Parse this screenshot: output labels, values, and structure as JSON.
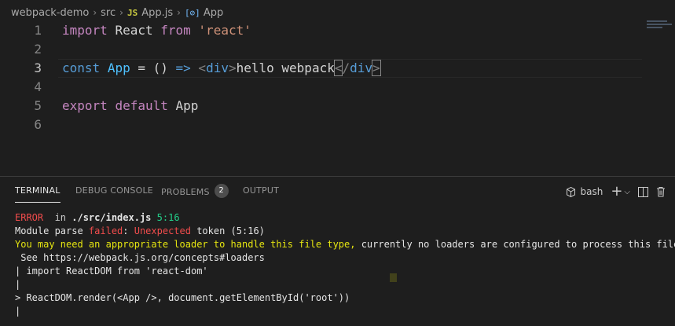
{
  "breadcrumb": {
    "items": [
      {
        "label": "webpack-demo"
      },
      {
        "label": "src"
      },
      {
        "label": "App.js",
        "icon": "JS"
      },
      {
        "label": "App",
        "icon": "[⊘]"
      }
    ]
  },
  "editor": {
    "lines": [
      {
        "num": "1",
        "tokens": [
          [
            "kw",
            "import"
          ],
          [
            "op",
            " "
          ],
          [
            "txt",
            "React"
          ],
          [
            "op",
            " "
          ],
          [
            "kw",
            "from"
          ],
          [
            "op",
            " "
          ],
          [
            "str",
            "'react'"
          ]
        ]
      },
      {
        "num": "2",
        "tokens": []
      },
      {
        "num": "3",
        "active": true,
        "tokens": [
          [
            "kw2",
            "const"
          ],
          [
            "op",
            " "
          ],
          [
            "var",
            "App"
          ],
          [
            "op",
            " = () "
          ],
          [
            "kw2",
            "=>"
          ],
          [
            "op",
            " "
          ],
          [
            "ang",
            "<"
          ],
          [
            "tag",
            "div"
          ],
          [
            "ang",
            ">"
          ],
          [
            "txt",
            "hello webpack"
          ],
          [
            "ang",
            "<"
          ],
          [
            "ang",
            "/"
          ],
          [
            "tag",
            "div"
          ],
          [
            "ang",
            ">"
          ]
        ]
      },
      {
        "num": "4",
        "tokens": []
      },
      {
        "num": "5",
        "tokens": [
          [
            "kw",
            "export"
          ],
          [
            "op",
            " "
          ],
          [
            "kw",
            "default"
          ],
          [
            "op",
            " "
          ],
          [
            "txt",
            "App"
          ]
        ]
      },
      {
        "num": "6",
        "tokens": []
      }
    ]
  },
  "panel": {
    "tabs": [
      {
        "label": "TERMINAL",
        "active": true
      },
      {
        "label": "DEBUG CONSOLE"
      },
      {
        "label": "PROBLEMS",
        "badge": "2"
      },
      {
        "label": "OUTPUT"
      }
    ],
    "shell_label": "bash",
    "icons": {
      "shell": "terminal-shell-icon",
      "new": "plus-icon",
      "dropdown": "chevron-down-icon",
      "split": "split-terminal-icon",
      "kill": "trash-icon"
    }
  },
  "terminal": {
    "lines": [
      [
        [
          "t-red",
          "ERROR"
        ],
        [
          "",
          "  in "
        ],
        [
          "t-white t-bold",
          "./src/index.js"
        ],
        [
          "",
          " "
        ],
        [
          "t-green",
          "5:16"
        ]
      ],
      [
        [
          "t-white",
          "Module parse "
        ],
        [
          "t-red",
          "failed"
        ],
        [
          "t-white",
          ": "
        ],
        [
          "t-red",
          "Unexpected"
        ],
        [
          "t-white",
          " token (5:16)"
        ]
      ],
      [
        [
          "t-yellow",
          "You may need an appropriate loader to handle this file type,"
        ],
        [
          "t-white",
          " currently no loaders are configured to process this file."
        ]
      ],
      [
        [
          "t-white",
          " See https://webpack.js.org/concepts#loaders"
        ]
      ],
      [
        [
          "t-white",
          "| import ReactDOM from 'react-dom'"
        ]
      ],
      [
        [
          "t-white",
          "|"
        ]
      ],
      [
        [
          "t-white",
          "> ReactDOM.render(<App />, document.getElementById('root'))"
        ]
      ],
      [
        [
          "t-white",
          "|"
        ]
      ]
    ]
  },
  "colors": {
    "background": "#1e1e1e",
    "keyword": "#c586c0",
    "keyword_blue": "#569cd6",
    "string": "#ce9178",
    "error": "#f14c4c",
    "success": "#23d18b",
    "warning": "#e5e510"
  }
}
